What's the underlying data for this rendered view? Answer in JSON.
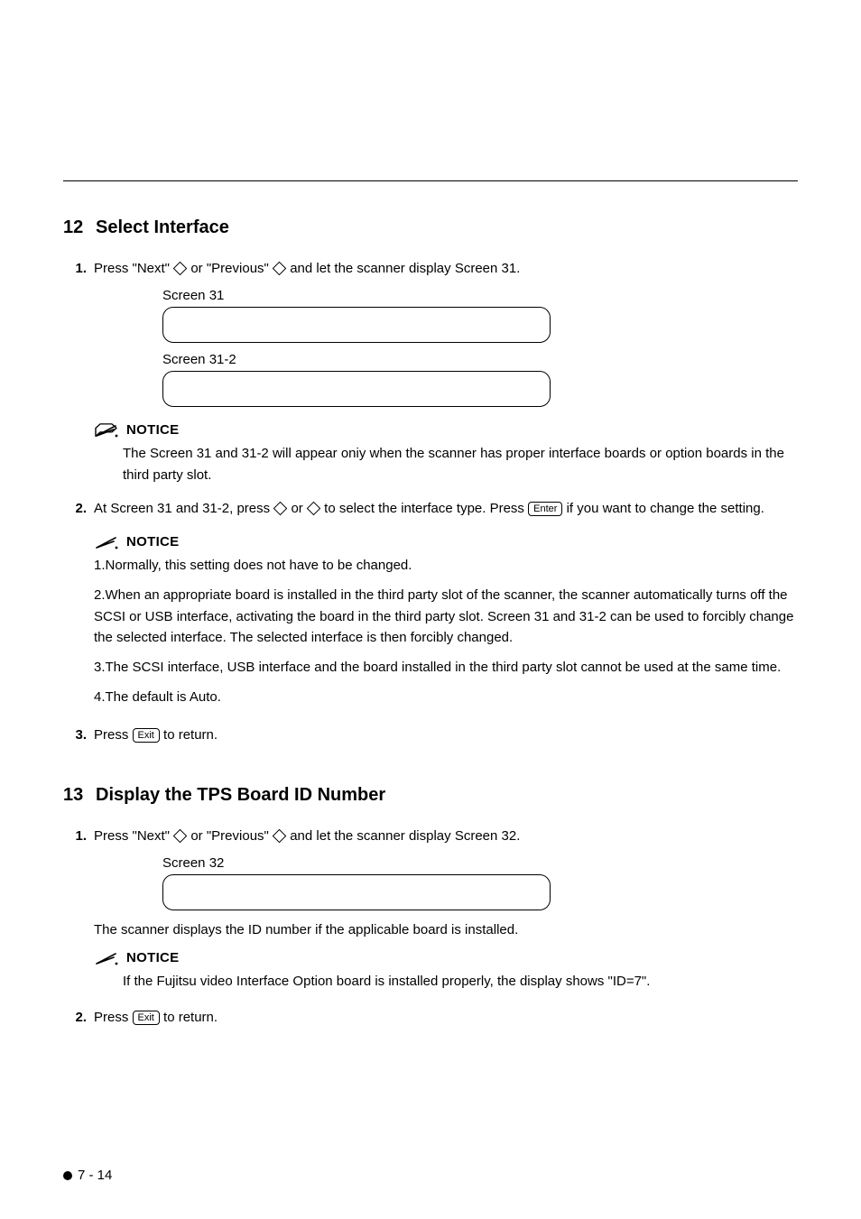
{
  "section12": {
    "num": "12",
    "title": "Select Interface",
    "step1": {
      "num": "1.",
      "pre": "Press \"Next\" ",
      "mid": " or \"Previous\" ",
      "post": " and let the scanner display Screen 31.",
      "screen_a_label": "Screen 31",
      "screen_b_label": "Screen 31-2"
    },
    "notice1": {
      "label": "NOTICE",
      "text": "The Screen 31 and 31-2 will appear oniy when the scanner has proper interface boards or option boards in the third party slot."
    },
    "step2": {
      "num": "2.",
      "pre": "At Screen 31 and 31-2, press ",
      "mid": " or ",
      "post_a": " to select the interface type. Press ",
      "key": "Enter",
      "post_b": " if you want to change the setting."
    },
    "notice2": {
      "label": "NOTICE",
      "p1": "1.Normally, this setting does not have to be changed.",
      "p2": "2.When an appropriate board is installed in the third party slot of the scanner, the scanner automatically turns off the SCSI or USB interface, activating the board in the third party slot. Screen 31 and 31-2 can be used to forcibly change the selected interface. The selected interface is then forcibly changed.",
      "p3": "3.The SCSI interface, USB interface and the board installed in the third party slot cannot be used at the same time.",
      "p4": "4.The default is Auto."
    },
    "step3": {
      "num": "3.",
      "pre": "Press ",
      "key": "Exit",
      "post": " to return."
    }
  },
  "section13": {
    "num": "13",
    "title": "Display the TPS Board ID Number",
    "step1": {
      "num": "1.",
      "pre": "Press \"Next\" ",
      "mid": " or \"Previous\" ",
      "post": " and let the scanner display Screen 32.",
      "screen_label": "Screen 32",
      "after": "The scanner displays the ID number if the applicable board is installed."
    },
    "notice1": {
      "label": "NOTICE",
      "text": "If the Fujitsu video Interface Option board is installed properly, the display shows \"ID=7\"."
    },
    "step2": {
      "num": "2.",
      "pre": "Press ",
      "key": "Exit",
      "post": " to return."
    }
  },
  "footer": "7 - 14"
}
